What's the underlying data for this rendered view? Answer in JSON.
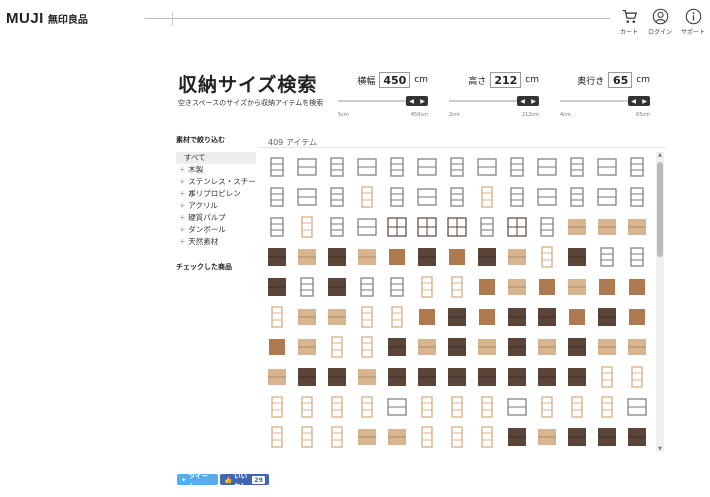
{
  "header": {
    "logo_en": "MUJI",
    "logo_jp": "無印良品",
    "nav": [
      {
        "label": "カート",
        "icon": "cart-icon"
      },
      {
        "label": "ログイン",
        "icon": "user-icon"
      },
      {
        "label": "サポート",
        "icon": "info-icon"
      }
    ]
  },
  "page": {
    "title": "収納サイズ検索",
    "subtitle": "空きスペースのサイズから収納アイテムを検索"
  },
  "controls": {
    "width": {
      "label": "横幅",
      "value": "450",
      "unit": "cm",
      "min": "5cm",
      "max": "450cm",
      "fraction": 1.0
    },
    "height": {
      "label": "高さ",
      "value": "212",
      "unit": "cm",
      "min": "2cm",
      "max": "212cm",
      "fraction": 1.0
    },
    "depth": {
      "label": "奥行き",
      "value": "65",
      "unit": "cm",
      "min": "4cm",
      "max": "65cm",
      "fraction": 1.0
    }
  },
  "sidebar": {
    "heading": "素材で絞り込む",
    "items": [
      "すべて",
      "木製",
      "ステンレス・スチール",
      "ポリプロピレン",
      "アクリル",
      "硬質パルプ",
      "ダンボール",
      "天然素材"
    ],
    "selected_index": 0,
    "checked_heading": "チェックした商品"
  },
  "results": {
    "count_text": "409 アイテム"
  },
  "share": {
    "tweet_label": "ツイート",
    "like_label": "いいね！",
    "like_count": "29"
  },
  "colors": {
    "tweet": "#55acee",
    "like": "#4267b2",
    "light_wood": "#d8b58e",
    "mid_wood": "#b07a50",
    "dark_wood": "#5b4438",
    "steel": "#7a7a7a"
  }
}
